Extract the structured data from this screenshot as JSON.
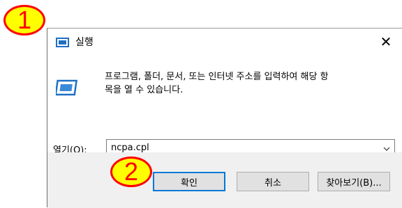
{
  "window": {
    "title": "실행",
    "close_glyph": "✕"
  },
  "description": {
    "line1": "프로그램, 폴더, 문서, 또는 인터넷 주소를 입력하여 해당 항",
    "line2": "목을 열 수 있습니다."
  },
  "open_field": {
    "label": "열기(O):",
    "value": "ncpa.cpl"
  },
  "buttons": {
    "ok": "확인",
    "cancel": "취소",
    "browse": "찾아보기(B)..."
  },
  "annotations": {
    "step1": "1",
    "step2": "2"
  },
  "colors": {
    "badge_fill": "#ffff00",
    "badge_border": "#ff0000",
    "ok_border": "#0078d7",
    "icon_blue": "#1f6fc5"
  },
  "icons": {
    "title": "run-dialog-icon",
    "content": "run-program-icon",
    "dropdown": "chevron-down-icon"
  }
}
